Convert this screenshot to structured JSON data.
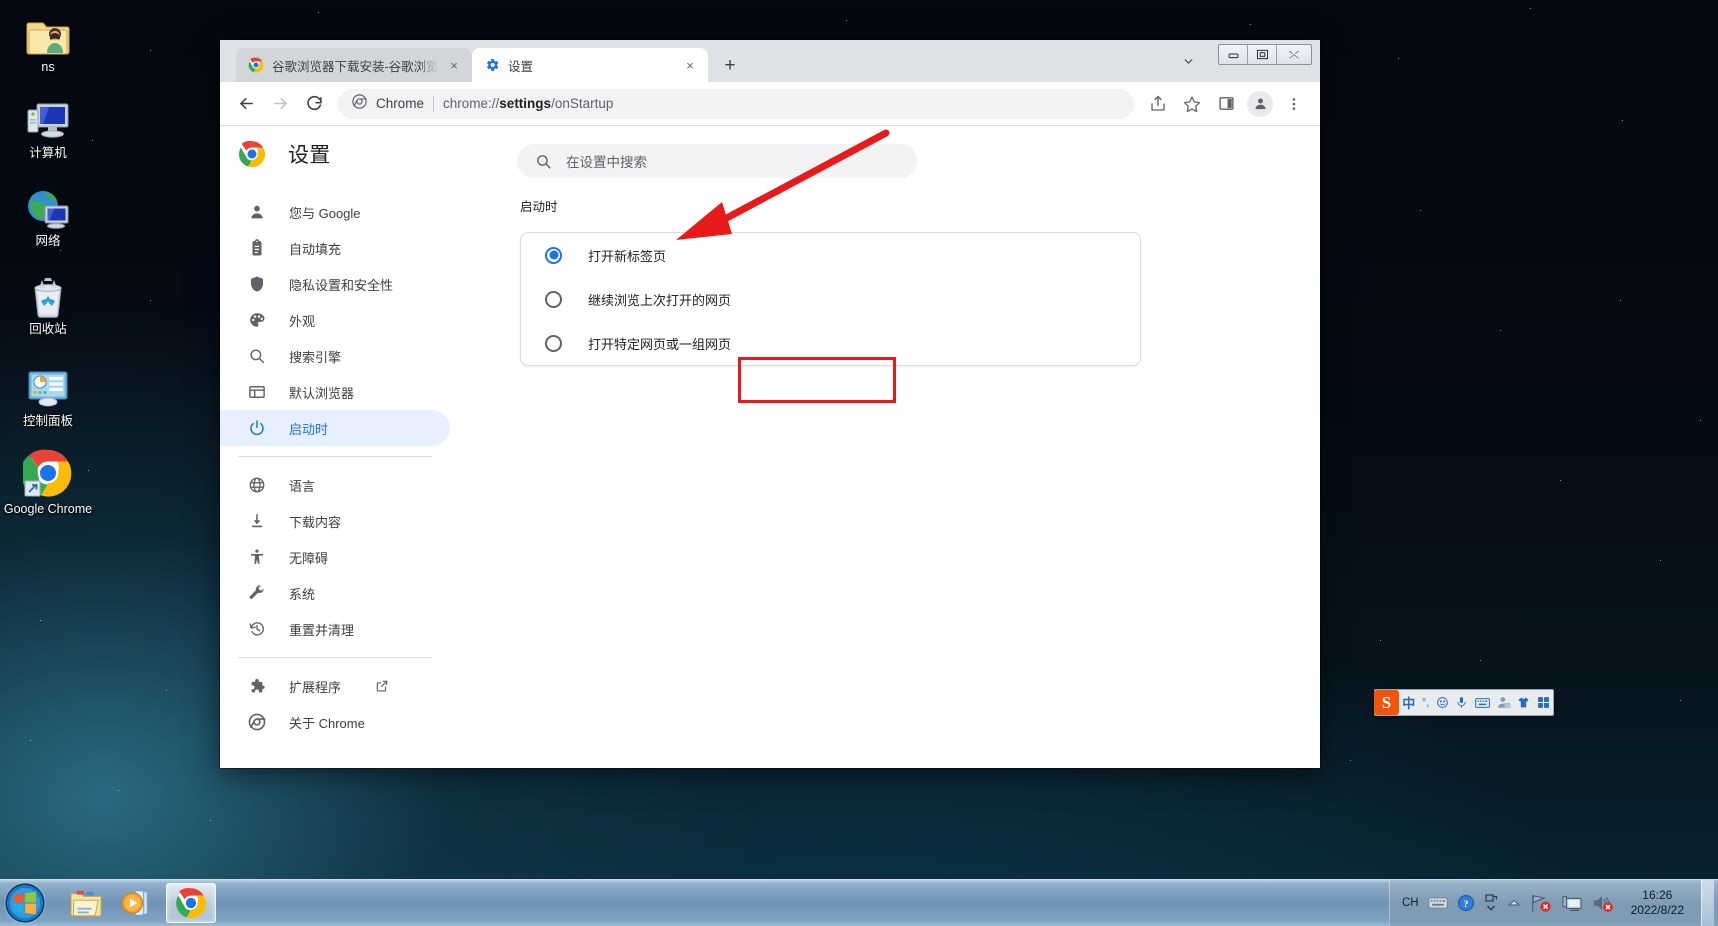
{
  "desktop": {
    "icons": [
      {
        "name": "ns",
        "icon": "user-folder-icon"
      },
      {
        "name": "计算机",
        "icon": "computer-icon"
      },
      {
        "name": "网络",
        "icon": "network-icon"
      },
      {
        "name": "回收站",
        "icon": "recycle-bin-icon"
      },
      {
        "name": "控制面板",
        "icon": "control-panel-icon"
      },
      {
        "name": "Google Chrome",
        "icon": "chrome-icon"
      }
    ]
  },
  "browser": {
    "tabs": [
      {
        "title": "谷歌浏览器下载安装-谷歌浏览器",
        "favicon": "chrome-icon",
        "active": false,
        "close_label": "×"
      },
      {
        "title": "设置",
        "favicon": "settings-gear-icon",
        "active": true,
        "close_label": "×"
      }
    ],
    "new_tab_label": "+",
    "window_controls": {
      "minimize": "–",
      "maximize": "❐",
      "close": "✕"
    },
    "toolbar": {
      "back_label": "←",
      "forward_label": "→",
      "reload_label": "⟳",
      "omnibox": {
        "scheme_label": "Chrome",
        "url_prefix": "chrome://",
        "url_bold": "settings",
        "url_suffix": "/onStartup"
      },
      "share_icon": "share-icon",
      "bookmark_icon": "star-icon",
      "sidepanel_icon": "side-panel-icon",
      "profile_icon": "profile-avatar-icon",
      "menu_icon": "three-dot-menu-icon"
    }
  },
  "settings": {
    "title": "设置",
    "logo_icon": "chrome-logo-icon",
    "search": {
      "placeholder": "在设置中搜索",
      "icon": "search-icon"
    },
    "sidebar": [
      {
        "label": "您与 Google",
        "icon": "person-icon",
        "selected": false
      },
      {
        "label": "自动填充",
        "icon": "clipboard-icon",
        "selected": false
      },
      {
        "label": "隐私设置和安全性",
        "icon": "shield-icon",
        "selected": false
      },
      {
        "label": "外观",
        "icon": "palette-icon",
        "selected": false
      },
      {
        "label": "搜索引擎",
        "icon": "search-icon",
        "selected": false
      },
      {
        "label": "默认浏览器",
        "icon": "browser-window-icon",
        "selected": false
      },
      {
        "label": "启动时",
        "icon": "power-icon",
        "selected": true
      },
      {
        "label": "语言",
        "icon": "globe-icon",
        "selected": false
      },
      {
        "label": "下载内容",
        "icon": "download-icon",
        "selected": false
      },
      {
        "label": "无障碍",
        "icon": "accessibility-icon",
        "selected": false
      },
      {
        "label": "系统",
        "icon": "wrench-icon",
        "selected": false
      },
      {
        "label": "重置并清理",
        "icon": "history-restore-icon",
        "selected": false
      },
      {
        "label": "扩展程序",
        "icon": "puzzle-icon",
        "selected": false,
        "external": true
      },
      {
        "label": "关于 Chrome",
        "icon": "chrome-outline-icon",
        "selected": false
      }
    ],
    "section_title": "启动时",
    "startup_options": [
      {
        "label": "打开新标签页",
        "selected": true
      },
      {
        "label": "继续浏览上次打开的网页",
        "selected": false
      },
      {
        "label": "打开特定网页或一组网页",
        "selected": false
      }
    ],
    "annotation": {
      "highlight_color": "#e81a1a",
      "arrow_color": "#e81a1a"
    }
  },
  "ime": {
    "logo_label": "S",
    "items": [
      {
        "label": "中",
        "icon": "chinese-mode-icon"
      },
      {
        "label": "°,",
        "icon": "punctuation-icon"
      },
      {
        "label": "☺",
        "icon": "emoji-icon"
      },
      {
        "label": "Ἲ4",
        "icon": "microphone-icon"
      },
      {
        "label": "⌨",
        "icon": "soft-keyboard-icon"
      },
      {
        "label": "",
        "icon": "user-account-icon"
      },
      {
        "label": "",
        "icon": "skin-shirt-icon"
      },
      {
        "label": "",
        "icon": "toolbox-grid-icon"
      }
    ]
  },
  "taskbar": {
    "start_label": "start-orb-icon",
    "pinned": [
      {
        "name": "文件资源管理器",
        "icon": "explorer-icon",
        "running": false
      },
      {
        "name": "Windows Media Player",
        "icon": "media-player-icon",
        "running": false
      },
      {
        "name": "Google Chrome",
        "icon": "chrome-icon",
        "running": true
      }
    ],
    "tray": {
      "language_label": "CH",
      "icons": [
        {
          "name": "keyboard-icon"
        },
        {
          "name": "help-icon"
        },
        {
          "name": "show-hidden-icons-icon"
        },
        {
          "name": "chevron-up-icon"
        },
        {
          "name": "network-error-icon"
        },
        {
          "name": "action-center-icon"
        },
        {
          "name": "volume-muted-icon"
        }
      ],
      "clock_time": "16:26",
      "clock_date": "2022/8/22"
    }
  }
}
